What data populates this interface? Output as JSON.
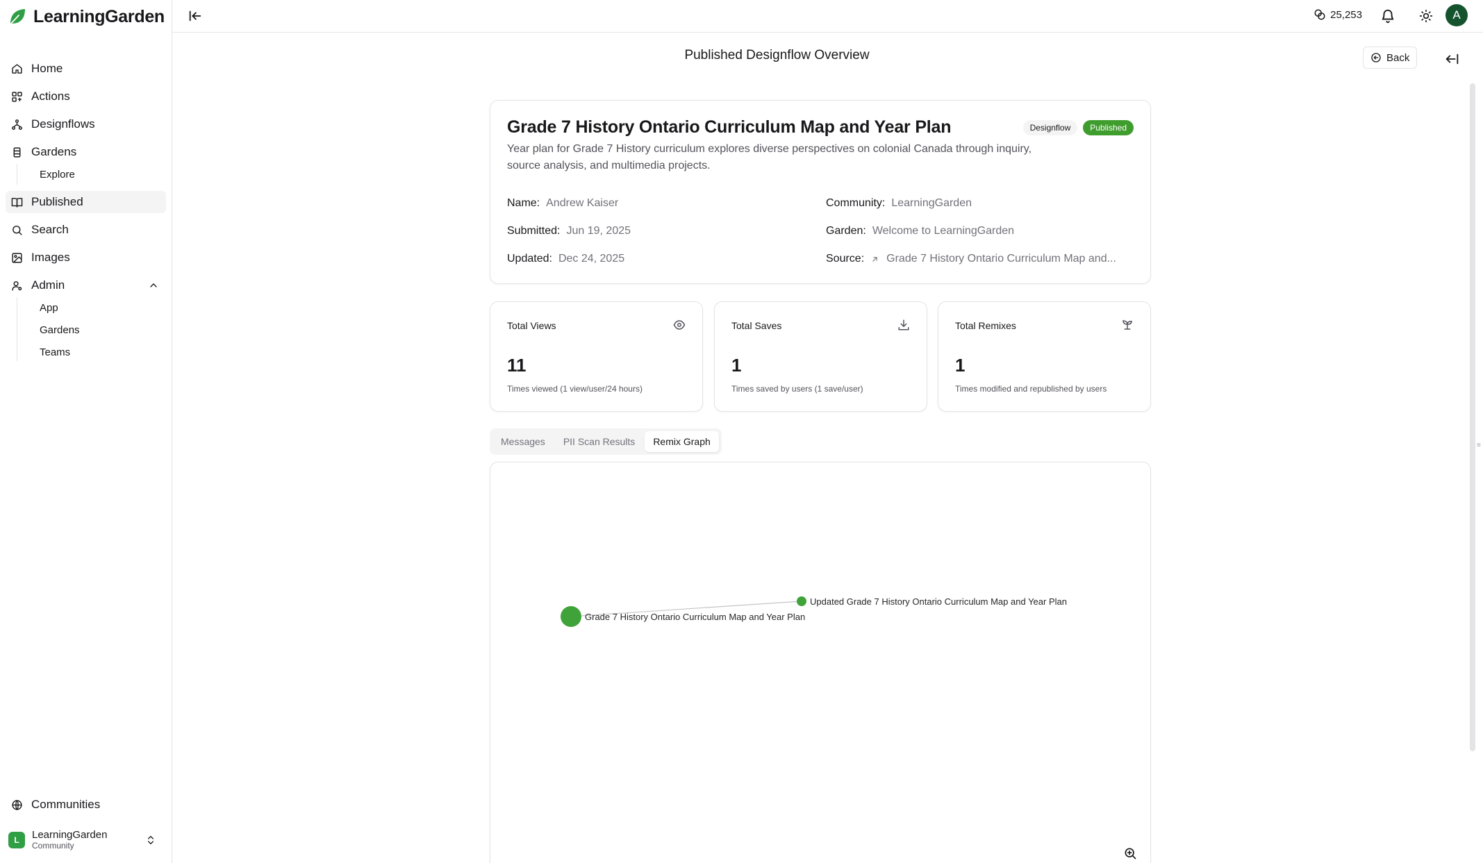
{
  "app": {
    "name": "LearningGarden"
  },
  "sidebar": {
    "items": [
      {
        "label": "Home",
        "icon": "home-icon"
      },
      {
        "label": "Actions",
        "icon": "actions-icon"
      },
      {
        "label": "Designflows",
        "icon": "designflows-icon"
      },
      {
        "label": "Gardens",
        "icon": "gardens-icon"
      },
      {
        "label": "Published",
        "icon": "book-icon",
        "active": true
      },
      {
        "label": "Search",
        "icon": "search-icon"
      },
      {
        "label": "Images",
        "icon": "image-icon"
      },
      {
        "label": "Admin",
        "icon": "admin-icon",
        "expanded": true
      }
    ],
    "gardens_sub": [
      "Explore"
    ],
    "admin_sub": [
      "App",
      "Gardens",
      "Teams"
    ],
    "communities_label": "Communities",
    "community": {
      "initial": "L",
      "name": "LearningGarden",
      "sub": "Community"
    }
  },
  "header": {
    "credits": "25,253",
    "avatar_initial": "A"
  },
  "page": {
    "title": "Published Designflow Overview",
    "back_label": "Back"
  },
  "designflow": {
    "title": "Grade 7 History Ontario Curriculum Map and Year Plan",
    "description": "Year plan for Grade 7 History curriculum explores diverse perspectives on colonial Canada through inquiry, source analysis, and multimedia projects.",
    "badges": [
      "Designflow",
      "Published"
    ],
    "meta": {
      "name_key": "Name:",
      "name_val": "Andrew Kaiser",
      "submitted_key": "Submitted:",
      "submitted_val": "Jun 19, 2025",
      "updated_key": "Updated:",
      "updated_val": "Dec 24, 2025",
      "community_key": "Community:",
      "community_val": "LearningGarden",
      "garden_key": "Garden:",
      "garden_val": "Welcome to LearningGarden",
      "source_key": "Source:",
      "source_val": "Grade 7 History Ontario Curriculum Map and..."
    }
  },
  "stats": [
    {
      "label": "Total Views",
      "value": "11",
      "sub": "Times viewed (1 view/user/24 hours)",
      "icon": "eye-icon"
    },
    {
      "label": "Total Saves",
      "value": "1",
      "sub": "Times saved by users (1 save/user)",
      "icon": "download-icon"
    },
    {
      "label": "Total Remixes",
      "value": "1",
      "sub": "Times modified and republished by users",
      "icon": "sprout-icon"
    }
  ],
  "tabs": [
    "Messages",
    "PII Scan Results",
    "Remix Graph"
  ],
  "active_tab": "Remix Graph",
  "remix_graph": {
    "nodes": [
      {
        "label": "Grade 7 History Ontario Curriculum Map and Year Plan",
        "role": "source"
      },
      {
        "label": "Updated Grade 7 History Ontario Curriculum Map and Year Plan",
        "role": "remix"
      }
    ],
    "edges": [
      {
        "from": 0,
        "to": 1
      }
    ],
    "node_color": "#40a33a"
  }
}
